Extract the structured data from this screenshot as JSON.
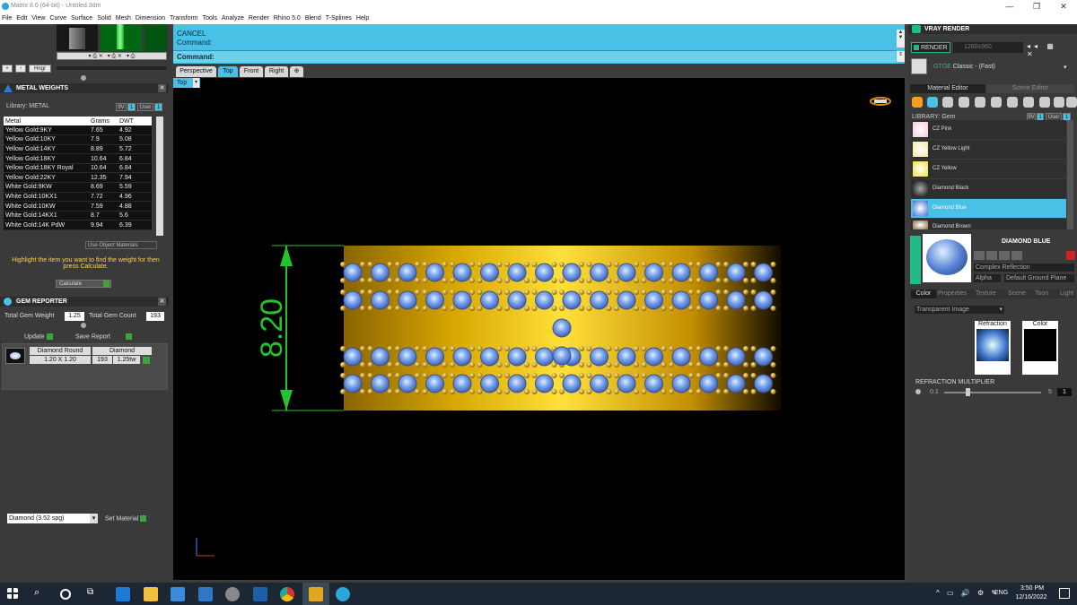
{
  "app": {
    "title": "Matrix 8.0 (64-bit) - Untitled.3dm",
    "window_controls": [
      "—",
      "❐",
      "✕"
    ],
    "menu": [
      "File",
      "Edit",
      "View",
      "Curve",
      "Surface",
      "Solid",
      "Mesh",
      "Dimension",
      "Transform",
      "Tools",
      "Analyze",
      "Render",
      "Rhino 5.0",
      "Blend",
      "T-Splines",
      "Help"
    ]
  },
  "left": {
    "hinge_label": "Hngr",
    "metal_weights": {
      "title": "METAL WEIGHTS",
      "library_label": "Library: METAL",
      "library_btns": [
        "9V",
        "1",
        "User",
        "1"
      ],
      "columns": [
        "Metal",
        "Grams",
        "DWT"
      ],
      "rows": [
        [
          "Yellow Gold:9KY",
          "7.65",
          "4.92"
        ],
        [
          "Yellow Gold:10KY",
          "7.9",
          "5.08"
        ],
        [
          "Yellow Gold:14KY",
          "8.89",
          "5.72"
        ],
        [
          "Yellow Gold:18KY",
          "10.64",
          "6.84"
        ],
        [
          "Yellow Gold:18KY Royal",
          "10.64",
          "6.84"
        ],
        [
          "Yellow Gold:22KY",
          "12.35",
          "7.94"
        ],
        [
          "White Gold:9KW",
          "8.69",
          "5.59"
        ],
        [
          "White Gold:10KX1",
          "7.72",
          "4.96"
        ],
        [
          "White Gold:10KW",
          "7.59",
          "4.88"
        ],
        [
          "White Gold:14KX1",
          "8.7",
          "5.6"
        ],
        [
          "White Gold:14K PdW",
          "9.94",
          "6.39"
        ]
      ],
      "use_object_materials": "Use Object Materials",
      "hint": "Highlight the item you want to find the weight for then press Calculate.",
      "calculate": "Calculate"
    },
    "gem_reporter": {
      "title": "GEM REPORTER",
      "total_weight_label": "Total Gem Weight",
      "total_weight": "1.25",
      "total_count_label": "Total Gem Count",
      "total_count": "193",
      "update": "Update",
      "save_report": "Save Report",
      "cols": [
        "Diamond Round",
        "Diamond"
      ],
      "row": [
        "1.20 X 1.20",
        "193",
        "1.25tw"
      ]
    },
    "material_select": "Diamond    (3.52 spg)",
    "set_material": "Set Material"
  },
  "command": {
    "line1": "CANCEL",
    "line2": "Command:",
    "prompt": "Command:"
  },
  "viewport": {
    "tabs": [
      "Perspective",
      "Top",
      "Front",
      "Right"
    ],
    "active_tab": "Top",
    "label": "Top",
    "dimension": "8.20"
  },
  "right": {
    "title": "VRAY RENDER",
    "render_btn": "RENDER",
    "resolution": "1280x960",
    "preset_prefix": "GTGE",
    "preset": "Classic - (Fast)",
    "tabs": [
      "Material Editor",
      "Scene Editor"
    ],
    "library_label": "LIBRARY: Gem",
    "library_btns": [
      "9V",
      "1",
      "User",
      "1"
    ],
    "materials": [
      "CZ Pink",
      "CZ Yellow Light",
      "CZ Yellow",
      "Diamond Black",
      "Diamond Blue",
      "Diamond Brown"
    ],
    "selected_material": "Diamond Blue",
    "material_name": "DIAMOND BLUE",
    "complex_reflection": "Complex Reflection",
    "alpha": "Alpha",
    "ground_plane": "Default Ground Plane",
    "sub_tabs": [
      "Color",
      "Properties",
      "Texture",
      "Scene",
      "Toon",
      "Light"
    ],
    "transparent": "Transparent Image",
    "refraction": "Refraction",
    "color": "Color",
    "refraction_multiplier": "REFRACTION MULTIPLIER",
    "slider_min": "0.1",
    "slider_max": "5",
    "slider_value": "1"
  },
  "taskbar": {
    "lang": "ENG",
    "time": "3:50 PM",
    "date": "12/16/2022"
  }
}
